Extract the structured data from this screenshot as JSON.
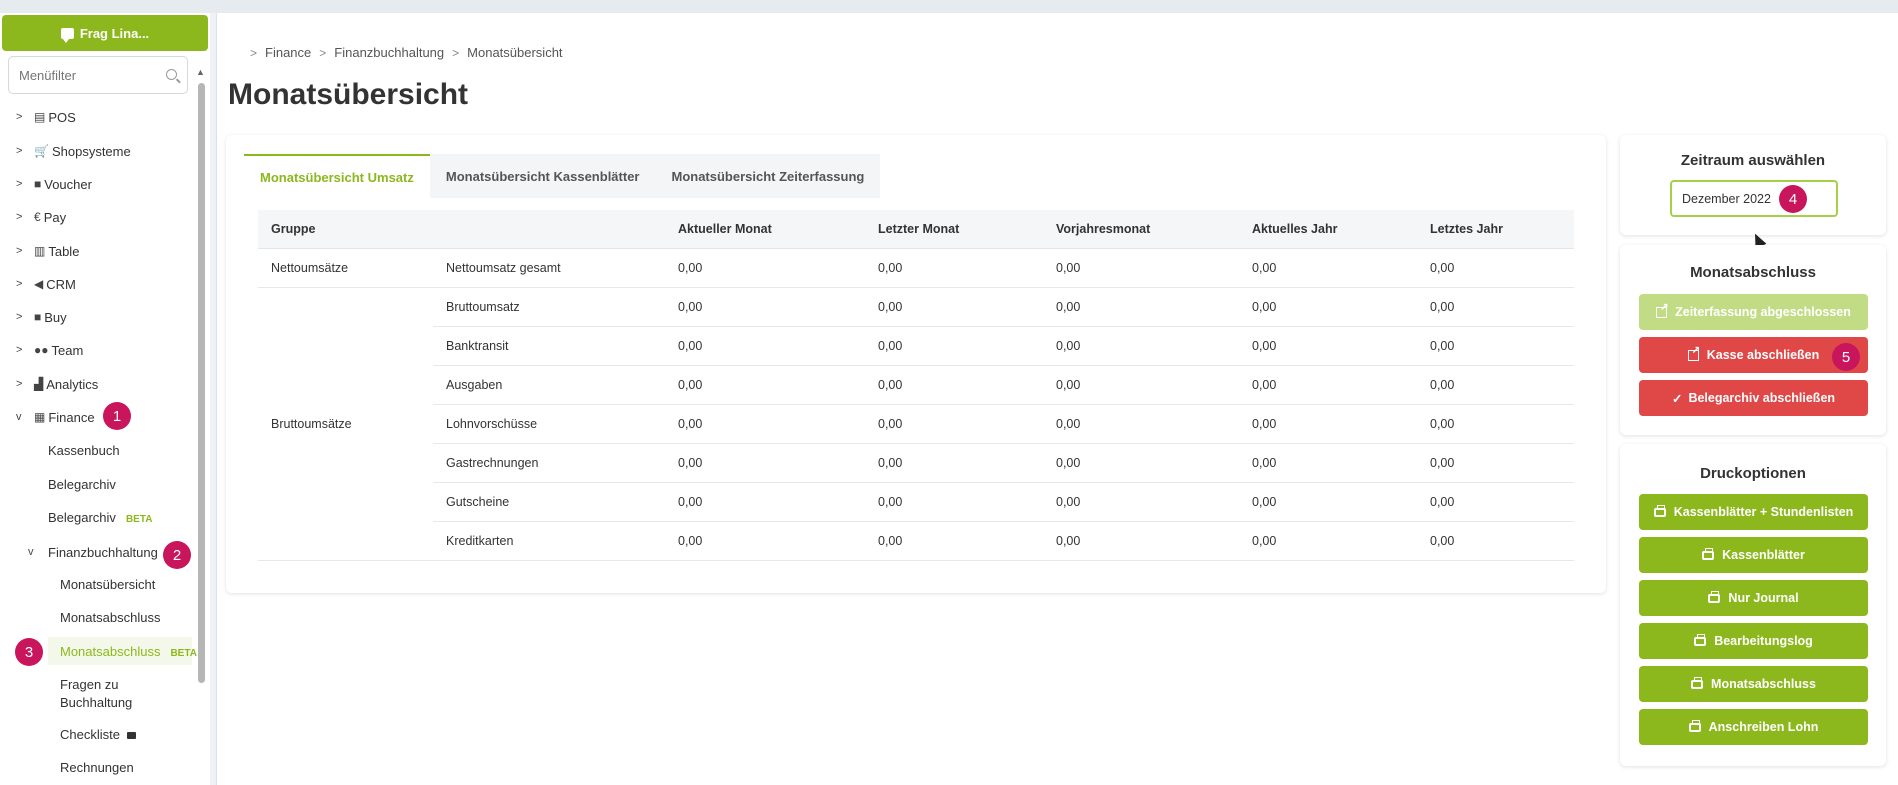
{
  "sidebar": {
    "ask_button": "Frag Lina...",
    "filter_placeholder": "Menüfilter",
    "items": [
      {
        "label": "POS",
        "icon": "cash-register-icon"
      },
      {
        "label": "Shopsysteme",
        "icon": "cart-icon"
      },
      {
        "label": "Voucher",
        "icon": "gift-icon"
      },
      {
        "label": "Pay",
        "icon": "euro-icon"
      },
      {
        "label": "Table",
        "icon": "book-icon"
      },
      {
        "label": "CRM",
        "icon": "megaphone-icon"
      },
      {
        "label": "Buy",
        "icon": "truck-icon"
      },
      {
        "label": "Team",
        "icon": "users-icon"
      },
      {
        "label": "Analytics",
        "icon": "chart-icon"
      },
      {
        "label": "Finance",
        "icon": "calculator-icon"
      }
    ],
    "finance_children": {
      "kassenbuch": "Kassenbuch",
      "belegarchiv": "Belegarchiv",
      "belegarchiv_beta": "Belegarchiv",
      "beta": "BETA",
      "finanzbuchhaltung": "Finanzbuchhaltung",
      "monatsuebersicht": "Monatsübersicht",
      "monatsabschluss": "Monatsabschluss",
      "monatsabschluss_beta": "Monatsabschluss",
      "fragen": "Fragen zu Buchhaltung",
      "checkliste": "Checkliste",
      "rechnungen": "Rechnungen"
    }
  },
  "badges": [
    "1",
    "2",
    "3",
    "4",
    "5"
  ],
  "breadcrumb": [
    "Finance",
    "Finanzbuchhaltung",
    "Monatsübersicht"
  ],
  "page_title": "Monatsübersicht",
  "tabs": [
    "Monatsübersicht Umsatz",
    "Monatsübersicht Kassenblätter",
    "Monatsübersicht Zeiterfassung"
  ],
  "table": {
    "headers": [
      "Gruppe",
      "",
      "Aktueller Monat",
      "Letzter Monat",
      "Vorjahresmonat",
      "Aktuelles Jahr",
      "Letztes Jahr"
    ],
    "groups": {
      "netto": "Nettoumsätze",
      "brutto": "Bruttoumsätze"
    },
    "rows": [
      {
        "label": "Nettoumsatz gesamt",
        "values": [
          "0,00",
          "0,00",
          "0,00",
          "0,00",
          "0,00"
        ]
      },
      {
        "label": "Bruttoumsatz",
        "values": [
          "0,00",
          "0,00",
          "0,00",
          "0,00",
          "0,00"
        ]
      },
      {
        "label": "Banktransit",
        "values": [
          "0,00",
          "0,00",
          "0,00",
          "0,00",
          "0,00"
        ]
      },
      {
        "label": "Ausgaben",
        "values": [
          "0,00",
          "0,00",
          "0,00",
          "0,00",
          "0,00"
        ]
      },
      {
        "label": "Lohnvorschüsse",
        "values": [
          "0,00",
          "0,00",
          "0,00",
          "0,00",
          "0,00"
        ]
      },
      {
        "label": "Gastrechnungen",
        "values": [
          "0,00",
          "0,00",
          "0,00",
          "0,00",
          "0,00"
        ]
      },
      {
        "label": "Gutscheine",
        "values": [
          "0,00",
          "0,00",
          "0,00",
          "0,00",
          "0,00"
        ]
      },
      {
        "label": "Kreditkarten",
        "values": [
          "0,00",
          "0,00",
          "0,00",
          "0,00",
          "0,00"
        ]
      }
    ]
  },
  "zeitraum": {
    "title": "Zeitraum auswählen",
    "value": "Dezember 2022"
  },
  "monatsabschluss": {
    "title": "Monatsabschluss",
    "buttons": [
      "Zeiterfassung abgeschlossen",
      "Kasse abschließen",
      "Belegarchiv abschließen"
    ]
  },
  "druckoptionen": {
    "title": "Druckoptionen",
    "buttons": [
      "Kassenblätter + Stundenlisten",
      "Kassenblätter",
      "Nur Journal",
      "Bearbeitungslog",
      "Monatsabschluss",
      "Anschreiben Lohn"
    ]
  },
  "colors": {
    "accent": "#8cb81d",
    "danger": "#e04848",
    "badge": "#c8155c"
  }
}
